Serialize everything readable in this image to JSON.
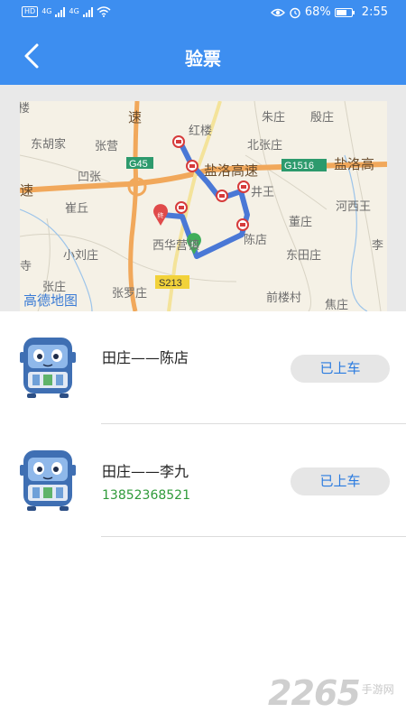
{
  "status_bar": {
    "left_icons": [
      "hd-icon",
      "4g-signal-icon",
      "4g-signal-icon",
      "wifi-icon"
    ],
    "signal_label_1": "4G",
    "signal_label_2": "4G",
    "hd_label": "HD",
    "right_icons": [
      "eye-icon",
      "alarm-icon",
      "battery-icon"
    ],
    "battery": "68%",
    "battery_level": 0.68,
    "time": "2:55"
  },
  "header": {
    "title": "验票",
    "back_icon": "chevron-left-icon"
  },
  "colors": {
    "header_bg": "#3d8ef0",
    "route_line": "#4a78d6",
    "phone_green": "#2f9a3a",
    "status_text": "#2a7be0"
  },
  "map": {
    "labels": {
      "l1": "楼",
      "l2": "速",
      "l3": "朱庄",
      "l4": "殷庄",
      "l5": "东胡家",
      "l6": "张营",
      "l7": "红楼",
      "l8": "北张庄",
      "l9": "G45",
      "l10": "盐洛高速",
      "l11": "G1516",
      "l12": "盐洛高",
      "l13": "凹张",
      "l14": "速",
      "l15": "井王",
      "l16": "崔丘",
      "l17": "河西王",
      "l18": "董庄",
      "l19": "西华营镇",
      "l20": "陈店",
      "l21": "李",
      "l22": "小刘庄",
      "l23": "东田庄",
      "l24": "寺",
      "l25": "张庄",
      "l26": "S213",
      "l27": "张罗庄",
      "l28": "前楼村",
      "l29": "焦庄",
      "l30": "高德地图",
      "start_marker": "起",
      "end_marker": "终"
    }
  },
  "trips": [
    {
      "route": "田庄——陈店",
      "phone": "",
      "status": "已上车"
    },
    {
      "route": "田庄——李九",
      "phone": "13852368521",
      "status": "已上车"
    }
  ],
  "watermark": {
    "number": "2265",
    "suffix": "手游网"
  }
}
